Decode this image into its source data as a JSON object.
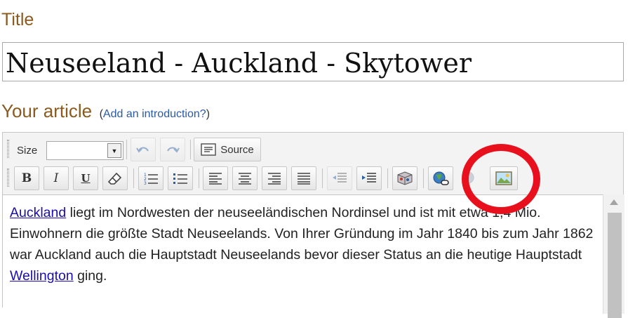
{
  "form": {
    "title_label": "Title",
    "title_value": "Neuseeland - Auckland - Skytower",
    "article_label": "Your article",
    "intro_open": "(",
    "intro_link": "Add an introduction?",
    "intro_close": ")"
  },
  "toolbar": {
    "size_label": "Size",
    "size_value": "",
    "source_label": "Source",
    "buttons": {
      "bold": "B",
      "italic": "I",
      "underline": "U"
    }
  },
  "content": {
    "link1": "Auckland",
    "text1": " liegt im Nordwesten der neuseeländischen Nordinsel und ist mit etwa 1,4 Mio. Einwohnern die größte Stadt Neuseelands. Von Ihrer Gründung im Jahr 1840 bis zum Jahr 1862 war Auckland auch die Hauptstadt Neuseelands bevor dieser Status an die heutige Hauptstadt ",
    "link2": "Wellington",
    "text2": " ging."
  },
  "colors": {
    "label_brown": "#8a5a1e",
    "link_blue": "#1a0dab",
    "highlight_red": "#e8101c"
  },
  "icons": [
    "undo-icon",
    "redo-icon",
    "source-icon",
    "eraser-icon",
    "numbered-list-icon",
    "bulleted-list-icon",
    "align-left-icon",
    "align-center-icon",
    "align-right-icon",
    "justify-icon",
    "outdent-icon",
    "indent-icon",
    "box-icon",
    "globe-link-icon",
    "unlink-icon",
    "image-icon"
  ]
}
